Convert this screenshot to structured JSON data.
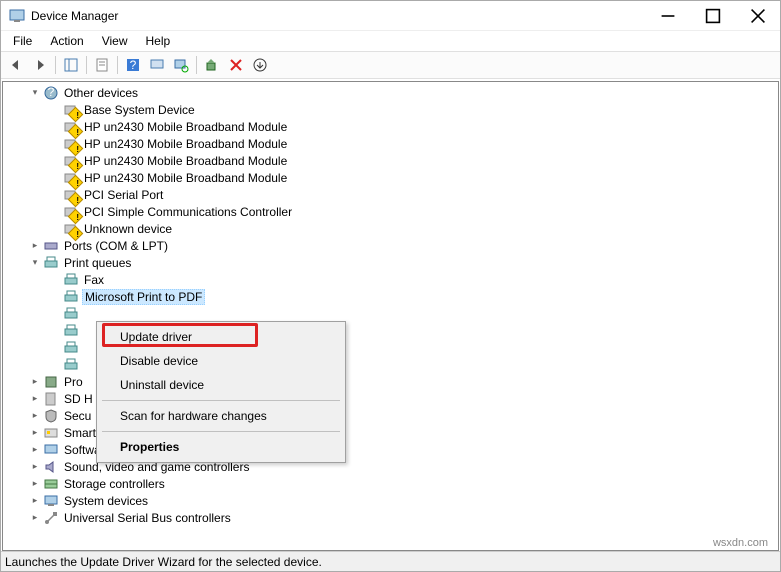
{
  "window": {
    "title": "Device Manager"
  },
  "menubar": {
    "file": "File",
    "action": "Action",
    "view": "View",
    "help": "Help"
  },
  "toolbar_icons": {
    "back": "back-arrow",
    "forward": "forward-arrow",
    "show_hide": "show-hide-console-tree",
    "properties_sheet": "properties-sheet",
    "help": "help",
    "action_center": "action-center",
    "scan": "scan-hardware",
    "update": "update-driver",
    "uninstall": "uninstall-device",
    "enable": "enable-device"
  },
  "tree": {
    "other_devices": {
      "label": "Other devices",
      "children": {
        "base_system": "Base System Device",
        "hp1": "HP un2430 Mobile Broadband Module",
        "hp2": "HP un2430 Mobile Broadband Module",
        "hp3": "HP un2430 Mobile Broadband Module",
        "hp4": "HP un2430 Mobile Broadband Module",
        "pci_serial": "PCI Serial Port",
        "pci_simple": "PCI Simple Communications Controller",
        "unknown": "Unknown device"
      }
    },
    "ports": "Ports (COM & LPT)",
    "print_queues": {
      "label": "Print queues",
      "children": {
        "fax": "Fax",
        "ms_pdf": "Microsoft Print to PDF",
        "hidden1": "",
        "hidden2": "",
        "hidden3": "",
        "hidden4": ""
      }
    },
    "processors": "Pro",
    "sd_host": "SD H",
    "security": "Secu",
    "smartcard": "Smart card readers",
    "software_devices": "Software devices",
    "sound": "Sound, video and game controllers",
    "storage": "Storage controllers",
    "system": "System devices",
    "usb": "Universal Serial Bus controllers"
  },
  "ctx_menu": {
    "update": "Update driver",
    "disable": "Disable device",
    "uninstall": "Uninstall device",
    "scan": "Scan for hardware changes",
    "properties": "Properties"
  },
  "statusbar": {
    "text": "Launches the Update Driver Wizard for the selected device."
  },
  "watermark": "wsxdn.com"
}
